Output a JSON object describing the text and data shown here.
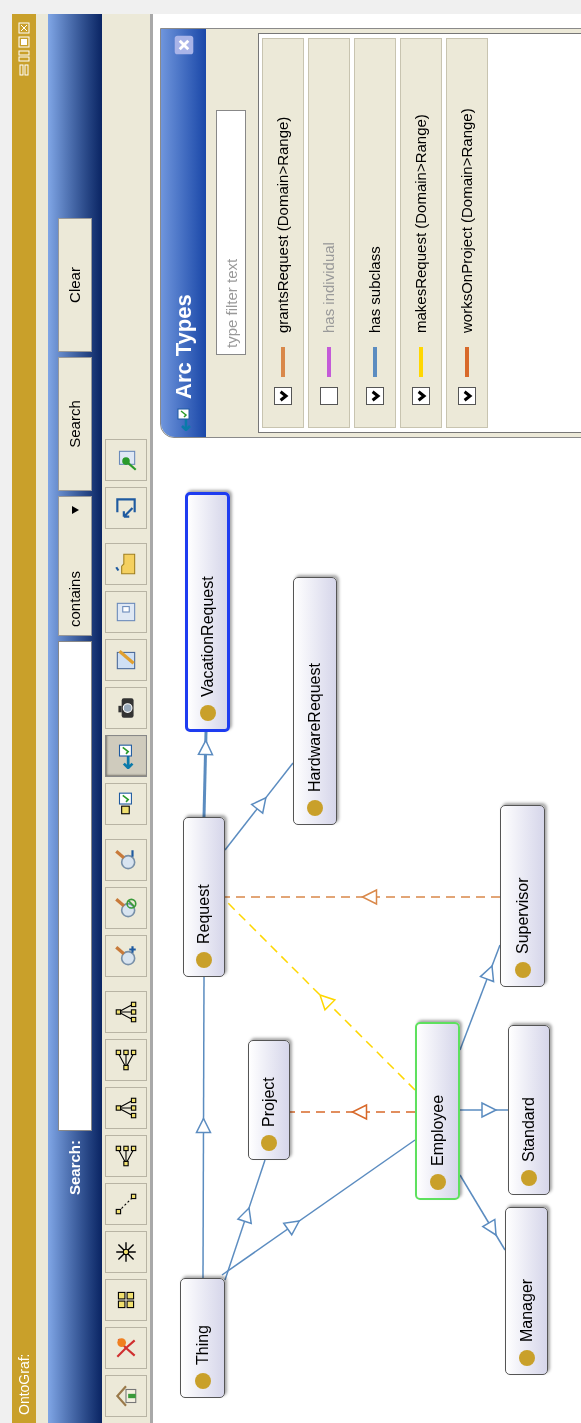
{
  "window": {
    "title": "OntoGraf:"
  },
  "window_buttons": [
    {
      "kind": "minimize"
    },
    {
      "kind": "tile"
    },
    {
      "kind": "maximize"
    },
    {
      "kind": "close"
    }
  ],
  "search": {
    "label": "Search:",
    "mode": "contains",
    "buttons": [
      "Search",
      "Clear"
    ]
  },
  "toolbar_groups": [
    {
      "buttons": [
        {
          "kind": "home",
          "selected": false
        },
        {
          "kind": "network",
          "selected": false
        },
        {
          "kind": "grid",
          "selected": false
        },
        {
          "kind": "radial",
          "selected": false
        },
        {
          "kind": "spring",
          "selected": false
        },
        {
          "kind": "tree-left",
          "selected": false
        },
        {
          "kind": "tree-down",
          "selected": false
        },
        {
          "kind": "tree-left",
          "selected": false
        },
        {
          "kind": "tree-down",
          "selected": false
        }
      ]
    },
    {
      "buttons": [
        {
          "kind": "zoom-in",
          "selected": false
        },
        {
          "kind": "zoom-reset",
          "selected": false
        },
        {
          "kind": "zoom-out",
          "selected": false
        }
      ]
    },
    {
      "buttons": [
        {
          "kind": "node-types",
          "selected": false
        },
        {
          "kind": "arc-types",
          "selected": true
        },
        {
          "kind": "camera",
          "selected": false
        },
        {
          "kind": "edit",
          "selected": false
        },
        {
          "kind": "document",
          "selected": false
        },
        {
          "kind": "folder",
          "selected": false
        }
      ]
    },
    {
      "buttons": [
        {
          "kind": "fit",
          "selected": false
        },
        {
          "kind": "export",
          "selected": false
        }
      ]
    }
  ],
  "nodes": [
    {
      "label": "Thing",
      "selected": false,
      "highlighted": false
    },
    {
      "label": "Project",
      "selected": false,
      "highlighted": false
    },
    {
      "label": "Request",
      "selected": false,
      "highlighted": false
    },
    {
      "label": "VacationRequest",
      "selected": true,
      "highlighted": false
    },
    {
      "label": "HardwareRequest",
      "selected": false,
      "highlighted": false
    },
    {
      "label": "Employee",
      "selected": false,
      "highlighted": true
    },
    {
      "label": "Supervisor",
      "selected": false,
      "highlighted": false
    },
    {
      "label": "Standard",
      "selected": false,
      "highlighted": false
    },
    {
      "label": "Manager",
      "selected": false,
      "highlighted": false
    }
  ],
  "arc_types": {
    "title": "Arc Types",
    "filter_placeholder": "type filter text",
    "items": [
      {
        "label": "grantsRequest (Domain>Range)",
        "color": "#d9884a",
        "checked": true
      },
      {
        "label": "has individual",
        "color": "#c45ad8",
        "checked": false
      },
      {
        "label": "has subclass",
        "color": "#5b8cc0",
        "checked": true
      },
      {
        "label": "makesRequest (Domain>Range)",
        "color": "#ffd700",
        "checked": true
      },
      {
        "label": "worksOnProject (Domain>Range)",
        "color": "#d8692a",
        "checked": true
      }
    ]
  }
}
